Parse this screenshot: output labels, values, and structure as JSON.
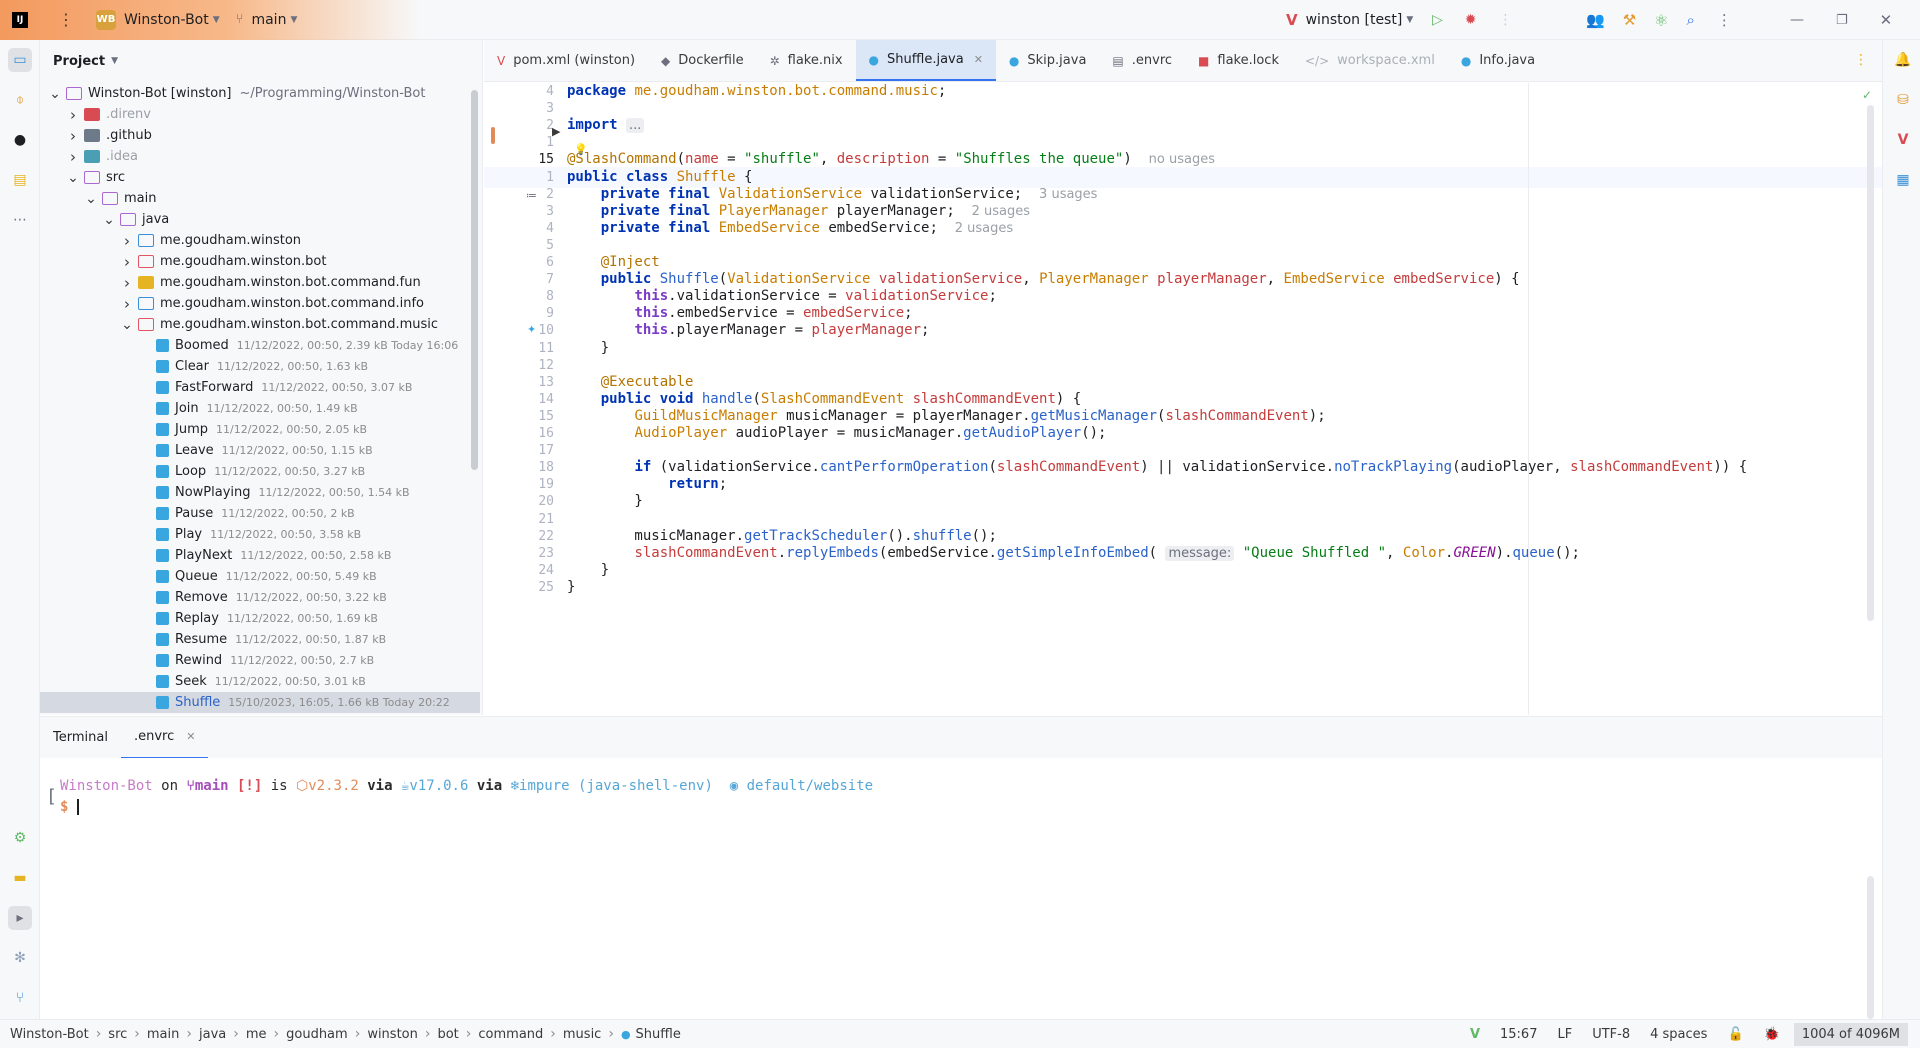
{
  "titlebar": {
    "app_logo": "IJ",
    "project_badge": "WB",
    "project_name": "Winston-Bot",
    "branch": "main",
    "run_config": "winston [test]"
  },
  "project_panel": {
    "title": "Project",
    "tree": [
      {
        "label": "Winston-Bot [winston]",
        "meta": "~/Programming/Winston-Bot",
        "depth": 0,
        "arrow": "open",
        "icon": "module"
      },
      {
        "label": ".direnv",
        "meta": "",
        "depth": 1,
        "arrow": "closed",
        "icon": "folder-red-solid",
        "dim": true
      },
      {
        "label": ".github",
        "meta": "",
        "depth": 1,
        "arrow": "closed",
        "icon": "folder-grey"
      },
      {
        "label": ".idea",
        "meta": "",
        "depth": 1,
        "arrow": "closed",
        "icon": "folder-teal",
        "dim": true
      },
      {
        "label": "src",
        "meta": "",
        "depth": 1,
        "arrow": "open",
        "icon": "folder"
      },
      {
        "label": "main",
        "meta": "",
        "depth": 2,
        "arrow": "open",
        "icon": "folder"
      },
      {
        "label": "java",
        "meta": "",
        "depth": 3,
        "arrow": "open",
        "icon": "folder"
      },
      {
        "label": "me.goudham.winston",
        "meta": "",
        "depth": 4,
        "arrow": "closed",
        "icon": "folder-blue"
      },
      {
        "label": "me.goudham.winston.bot",
        "meta": "",
        "depth": 4,
        "arrow": "closed",
        "icon": "folder-red"
      },
      {
        "label": "me.goudham.winston.bot.command.fun",
        "meta": "",
        "depth": 4,
        "arrow": "closed",
        "icon": "folder-yellow"
      },
      {
        "label": "me.goudham.winston.bot.command.info",
        "meta": "",
        "depth": 4,
        "arrow": "closed",
        "icon": "folder-blue"
      },
      {
        "label": "me.goudham.winston.bot.command.music",
        "meta": "",
        "depth": 4,
        "arrow": "open",
        "icon": "folder-red"
      },
      {
        "label": "Boomed",
        "meta": "11/12/2022, 00:50, 2.39 kB Today 16:06",
        "depth": 5,
        "arrow": "",
        "icon": "class"
      },
      {
        "label": "Clear",
        "meta": "11/12/2022, 00:50, 1.63 kB",
        "depth": 5,
        "arrow": "",
        "icon": "class"
      },
      {
        "label": "FastForward",
        "meta": "11/12/2022, 00:50, 3.07 kB",
        "depth": 5,
        "arrow": "",
        "icon": "class"
      },
      {
        "label": "Join",
        "meta": "11/12/2022, 00:50, 1.49 kB",
        "depth": 5,
        "arrow": "",
        "icon": "class"
      },
      {
        "label": "Jump",
        "meta": "11/12/2022, 00:50, 2.05 kB",
        "depth": 5,
        "arrow": "",
        "icon": "class"
      },
      {
        "label": "Leave",
        "meta": "11/12/2022, 00:50, 1.15 kB",
        "depth": 5,
        "arrow": "",
        "icon": "class"
      },
      {
        "label": "Loop",
        "meta": "11/12/2022, 00:50, 3.27 kB",
        "depth": 5,
        "arrow": "",
        "icon": "class"
      },
      {
        "label": "NowPlaying",
        "meta": "11/12/2022, 00:50, 1.54 kB",
        "depth": 5,
        "arrow": "",
        "icon": "class"
      },
      {
        "label": "Pause",
        "meta": "11/12/2022, 00:50, 2 kB",
        "depth": 5,
        "arrow": "",
        "icon": "class"
      },
      {
        "label": "Play",
        "meta": "11/12/2022, 00:50, 3.58 kB",
        "depth": 5,
        "arrow": "",
        "icon": "class"
      },
      {
        "label": "PlayNext",
        "meta": "11/12/2022, 00:50, 2.58 kB",
        "depth": 5,
        "arrow": "",
        "icon": "class"
      },
      {
        "label": "Queue",
        "meta": "11/12/2022, 00:50, 5.49 kB",
        "depth": 5,
        "arrow": "",
        "icon": "class"
      },
      {
        "label": "Remove",
        "meta": "11/12/2022, 00:50, 3.22 kB",
        "depth": 5,
        "arrow": "",
        "icon": "class"
      },
      {
        "label": "Replay",
        "meta": "11/12/2022, 00:50, 1.69 kB",
        "depth": 5,
        "arrow": "",
        "icon": "class"
      },
      {
        "label": "Resume",
        "meta": "11/12/2022, 00:50, 1.87 kB",
        "depth": 5,
        "arrow": "",
        "icon": "class"
      },
      {
        "label": "Rewind",
        "meta": "11/12/2022, 00:50, 2.7 kB",
        "depth": 5,
        "arrow": "",
        "icon": "class"
      },
      {
        "label": "Seek",
        "meta": "11/12/2022, 00:50, 3.01 kB",
        "depth": 5,
        "arrow": "",
        "icon": "class"
      },
      {
        "label": "Shuffle",
        "meta": "15/10/2023, 16:05, 1.66 kB Today 20:22",
        "depth": 5,
        "arrow": "",
        "icon": "class",
        "selected": true
      }
    ]
  },
  "tabs": [
    {
      "label": "pom.xml (winston)",
      "icon": "maven-icon",
      "icon_char": "V",
      "icon_color": "#d94b52"
    },
    {
      "label": "Dockerfile",
      "icon": "docker-icon",
      "icon_char": "◆",
      "icon_color": "#6c707e"
    },
    {
      "label": "flake.nix",
      "icon": "nix-icon",
      "icon_char": "✲",
      "icon_color": "#6c707e"
    },
    {
      "label": "Shuffle.java",
      "icon": "class-icon",
      "icon_char": "●",
      "icon_color": "#3aa6e0",
      "active": true,
      "close": "✕"
    },
    {
      "label": "Skip.java",
      "icon": "class-icon",
      "icon_char": "●",
      "icon_color": "#3aa6e0"
    },
    {
      "label": ".envrc",
      "icon": "file-icon",
      "icon_char": "▤",
      "icon_color": "#6c707e"
    },
    {
      "label": "flake.lock",
      "icon": "lock-icon",
      "icon_char": "■",
      "icon_color": "#d94b52"
    },
    {
      "label": "workspace.xml",
      "icon": "xml-icon",
      "icon_char": "</>",
      "icon_color": "#a9b0b8",
      "muted": true
    },
    {
      "label": "Info.java",
      "icon": "class-icon",
      "icon_char": "●",
      "icon_color": "#3aa6e0"
    }
  ],
  "editor": {
    "line_numbers": [
      "4",
      "3",
      "2",
      "1",
      "15",
      "1",
      "2",
      "3",
      "4",
      "5",
      "6",
      "7",
      "8",
      "9",
      "10",
      "11",
      "12",
      "13",
      "14",
      "15",
      "16",
      "17",
      "18",
      "19",
      "20",
      "21",
      "22",
      "23",
      "24",
      "25"
    ],
    "current_line_index": 4,
    "lines": [
      [
        [
          "kw",
          "package "
        ],
        [
          "pkg",
          "me.goudham.winston.bot.command.music"
        ],
        [
          "plain",
          ";"
        ]
      ],
      [],
      [
        [
          "kw",
          "import "
        ],
        [
          "hintbox",
          "..."
        ]
      ],
      [],
      [
        [
          "ann",
          "@SlashCommand"
        ],
        [
          "plain",
          "("
        ],
        [
          "param",
          "name"
        ],
        [
          "plain",
          " = "
        ],
        [
          "str",
          "\"shuffle\""
        ],
        [
          "plain",
          ", "
        ],
        [
          "param",
          "description"
        ],
        [
          "plain",
          " = "
        ],
        [
          "str",
          "\"Shuffles the queue\""
        ],
        [
          "plain",
          ")  "
        ],
        [
          "hint",
          "no usages"
        ]
      ],
      [
        [
          "kw",
          "public class "
        ],
        [
          "type",
          "Shuffle"
        ],
        [
          "plain",
          " {"
        ]
      ],
      [
        [
          "plain",
          "    "
        ],
        [
          "kw",
          "private final "
        ],
        [
          "type",
          "ValidationService"
        ],
        [
          "plain",
          " validationService;  "
        ],
        [
          "hint",
          "3 usages"
        ]
      ],
      [
        [
          "plain",
          "    "
        ],
        [
          "kw",
          "private final "
        ],
        [
          "type",
          "PlayerManager"
        ],
        [
          "plain",
          " playerManager;  "
        ],
        [
          "hint",
          "2 usages"
        ]
      ],
      [
        [
          "plain",
          "    "
        ],
        [
          "kw",
          "private final "
        ],
        [
          "type",
          "EmbedService"
        ],
        [
          "plain",
          " embedService;  "
        ],
        [
          "hint",
          "2 usages"
        ]
      ],
      [],
      [
        [
          "plain",
          "    "
        ],
        [
          "ann",
          "@Inject"
        ]
      ],
      [
        [
          "plain",
          "    "
        ],
        [
          "kw",
          "public "
        ],
        [
          "meth",
          "Shuffle"
        ],
        [
          "plain",
          "("
        ],
        [
          "type",
          "ValidationService"
        ],
        [
          "plain",
          " "
        ],
        [
          "param",
          "validationService"
        ],
        [
          "plain",
          ", "
        ],
        [
          "type",
          "PlayerManager"
        ],
        [
          "plain",
          " "
        ],
        [
          "param",
          "playerManager"
        ],
        [
          "plain",
          ", "
        ],
        [
          "type",
          "EmbedService"
        ],
        [
          "plain",
          " "
        ],
        [
          "param",
          "embedService"
        ],
        [
          "plain",
          ") {"
        ]
      ],
      [
        [
          "plain",
          "        "
        ],
        [
          "kwp",
          "this"
        ],
        [
          "plain",
          ".validationService = "
        ],
        [
          "param",
          "validationService"
        ],
        [
          "plain",
          ";"
        ]
      ],
      [
        [
          "plain",
          "        "
        ],
        [
          "kwp",
          "this"
        ],
        [
          "plain",
          ".embedService = "
        ],
        [
          "param",
          "embedService"
        ],
        [
          "plain",
          ";"
        ]
      ],
      [
        [
          "plain",
          "        "
        ],
        [
          "kwp",
          "this"
        ],
        [
          "plain",
          ".playerManager = "
        ],
        [
          "param",
          "playerManager"
        ],
        [
          "plain",
          ";"
        ]
      ],
      [
        [
          "plain",
          "    }"
        ]
      ],
      [],
      [
        [
          "plain",
          "    "
        ],
        [
          "ann",
          "@Executable"
        ]
      ],
      [
        [
          "plain",
          "    "
        ],
        [
          "kw",
          "public void "
        ],
        [
          "meth",
          "handle"
        ],
        [
          "plain",
          "("
        ],
        [
          "type",
          "SlashCommandEvent"
        ],
        [
          "plain",
          " "
        ],
        [
          "param",
          "slashCommandEvent"
        ],
        [
          "plain",
          ") {"
        ]
      ],
      [
        [
          "plain",
          "        "
        ],
        [
          "type",
          "GuildMusicManager"
        ],
        [
          "plain",
          " musicManager = playerManager."
        ],
        [
          "meth",
          "getMusicManager"
        ],
        [
          "plain",
          "("
        ],
        [
          "param",
          "slashCommandEvent"
        ],
        [
          "plain",
          ");"
        ]
      ],
      [
        [
          "plain",
          "        "
        ],
        [
          "type",
          "AudioPlayer"
        ],
        [
          "plain",
          " audioPlayer = musicManager."
        ],
        [
          "meth",
          "getAudioPlayer"
        ],
        [
          "plain",
          "();"
        ]
      ],
      [],
      [
        [
          "plain",
          "        "
        ],
        [
          "kw",
          "if "
        ],
        [
          "plain",
          "(validationService."
        ],
        [
          "meth",
          "cantPerformOperation"
        ],
        [
          "plain",
          "("
        ],
        [
          "param",
          "slashCommandEvent"
        ],
        [
          "plain",
          ") || validationService."
        ],
        [
          "meth",
          "noTrackPlaying"
        ],
        [
          "plain",
          "(audioPlayer, "
        ],
        [
          "param",
          "slashCommandEvent"
        ],
        [
          "plain",
          ")) {"
        ]
      ],
      [
        [
          "plain",
          "            "
        ],
        [
          "kw",
          "return"
        ],
        [
          "plain",
          ";"
        ]
      ],
      [
        [
          "plain",
          "        }"
        ]
      ],
      [],
      [
        [
          "plain",
          "        musicManager."
        ],
        [
          "meth",
          "getTrackScheduler"
        ],
        [
          "plain",
          "()."
        ],
        [
          "meth",
          "shuffle"
        ],
        [
          "plain",
          "();"
        ]
      ],
      [
        [
          "plain",
          "        "
        ],
        [
          "param",
          "slashCommandEvent"
        ],
        [
          "plain",
          "."
        ],
        [
          "meth",
          "replyEmbeds"
        ],
        [
          "plain",
          "(embedService."
        ],
        [
          "meth",
          "getSimpleInfoEmbed"
        ],
        [
          "plain",
          "( "
        ],
        [
          "hintbox",
          "message:"
        ],
        [
          "plain",
          " "
        ],
        [
          "str",
          "\"Queue Shuffled \""
        ],
        [
          "plain",
          ", "
        ],
        [
          "cls-ref",
          "Color"
        ],
        [
          "plain",
          "."
        ],
        [
          "const",
          "GREEN"
        ],
        [
          "plain",
          ")."
        ],
        [
          "meth",
          "queue"
        ],
        [
          "plain",
          "();"
        ]
      ],
      [
        [
          "plain",
          "    }"
        ]
      ],
      [
        [
          "plain",
          "}"
        ]
      ]
    ]
  },
  "terminal": {
    "tabs": [
      "Terminal",
      ".envrc"
    ],
    "prompt": {
      "dir": "Winston-Bot",
      "on": " on ",
      "branch_icon": "⑂",
      "branch": "main",
      "status": " [!]",
      "is": " is ",
      "pkg_icon": "⬡",
      "version": "v2.3.2",
      "via1": " via ",
      "java_icon": "☕",
      "java": "v17.0.6",
      "via2": " via ",
      "nix_icon": "❄",
      "nix": "impure (java-shell-env)",
      "ctx_icon": "◉",
      "ctx": "default/website",
      "symbol": "$"
    }
  },
  "statusbar": {
    "breadcrumb": [
      "Winston-Bot",
      "src",
      "main",
      "java",
      "me",
      "goudham",
      "winston",
      "bot",
      "command",
      "music",
      "Shuffle"
    ],
    "position": "15:67",
    "line_ending": "LF",
    "encoding": "UTF-8",
    "indent": "4 spaces",
    "memory": "1004 of 4096M"
  }
}
